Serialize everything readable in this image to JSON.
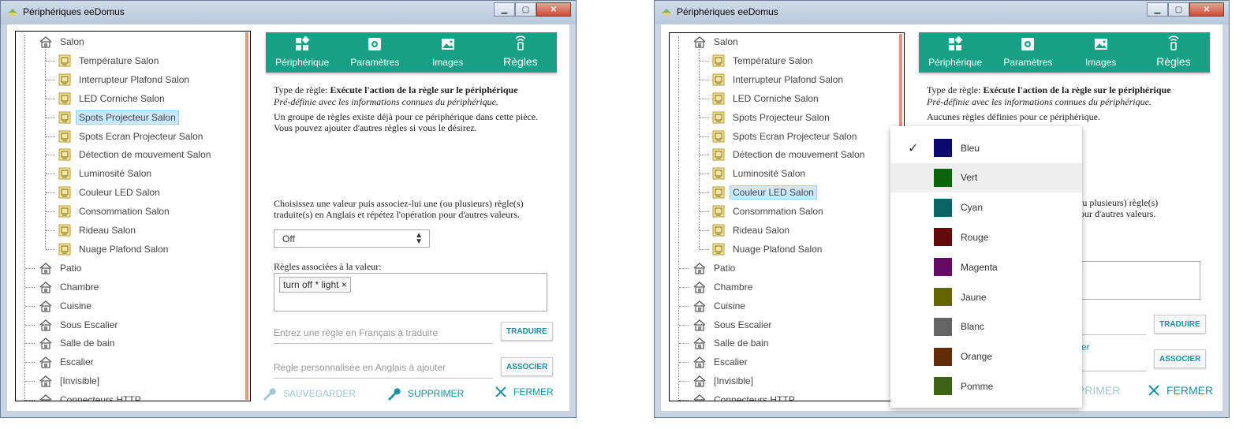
{
  "left_window": {
    "title": "Périphériques eeDomus",
    "tree": {
      "root_label": "Salon",
      "children": [
        "Température Salon",
        "Interrupteur Plafond Salon",
        "LED Corniche Salon",
        "Spots Projecteur Salon",
        "Spots Ecran Projecteur Salon",
        "Détection de mouvement Salon",
        "Luminosité Salon",
        "Couleur LED Salon",
        "Consommation Salon",
        "Rideau Salon",
        "Nuage Plafond Salon"
      ],
      "selected_child": "Spots Projecteur Salon",
      "rooms": [
        "Patio",
        "Chambre",
        "Cuisine",
        "Sous Escalier",
        "Salle de bain",
        "Escalier",
        "[Invisible]",
        "Connecteurs HTTP"
      ]
    },
    "tabs": [
      "Périphérique",
      "Paramètres",
      "Images",
      "Règles"
    ],
    "active_tab": "Règles",
    "rule_type_prefix": "Type de règle: ",
    "rule_type_value": "Exécute l'action de la règle sur le périphérique",
    "rule_type_desc": "Pré-définie avec les informations connues du périphérique.",
    "info_line1": "Un groupe de règles existe déjà pour ce périphérique dans cette pièce.",
    "info_line2": "Vous pouvez ajouter d'autres règles si vous le désirez.",
    "choose_line1": "Choisissez une valeur puis associez-lui une (ou plusieurs) règle(s)",
    "choose_line2": "traduite(s) en Anglais et répétez l'opération pour d'autres valeurs.",
    "select_value": "Off",
    "assoc_label": "Règles associées à la valeur:",
    "tag": "turn off * light",
    "tag_remove": "×",
    "translate_placeholder": "Entrez une règle en Français à traduire",
    "translate_button": "TRADUIRE",
    "custom_placeholder": "Règle personnalisée en Anglais à ajouter",
    "associate_button": "ASSOCIER",
    "save_label": "SAUVEGARDER",
    "delete_label": "SUPPRIMER",
    "close_label": "FERMER"
  },
  "right_window": {
    "title": "Périphériques eeDomus",
    "tree": {
      "root_label": "Salon",
      "children": [
        "Température Salon",
        "Interrupteur Plafond Salon",
        "LED Corniche Salon",
        "Spots Projecteur Salon",
        "Spots Ecran Projecteur Salon",
        "Détection de mouvement Salon",
        "Luminosité Salon",
        "Couleur LED Salon",
        "Consommation Salon",
        "Rideau Salon",
        "Nuage Plafond Salon"
      ],
      "selected_child": "Couleur LED Salon",
      "rooms": [
        "Patio",
        "Chambre",
        "Cuisine",
        "Sous Escalier",
        "Salle de bain",
        "Escalier",
        "[Invisible]",
        "Connecteurs HTTP"
      ]
    },
    "tabs": [
      "Périphérique",
      "Paramètres",
      "Images",
      "Règles"
    ],
    "active_tab": "Règles",
    "rule_type_prefix": "Type de règle: ",
    "rule_type_value": "Exécute l'action de la règle sur le périphérique",
    "rule_type_desc": "Pré-définie avec les informations connues du périphérique.",
    "info_line1": "Aucunes règles définies pour ce périphérique.",
    "choose_partial1": "e (ou plusieurs) règle(s)",
    "choose_partial2": "n pour d'autres valeurs.",
    "translate_partial": "re",
    "custom_partial": "uter",
    "translate_button": "TRADUIRE",
    "associate_button": "ASSOCIER",
    "save_partial": "IPRIMER",
    "close_label": "FERMER"
  },
  "color_dropdown": {
    "selected": "Bleu",
    "hovered": "Vert",
    "check_mark": "✓",
    "options": [
      {
        "label": "Bleu",
        "color": "#0a0a6e"
      },
      {
        "label": "Vert",
        "color": "#0a640a"
      },
      {
        "label": "Cyan",
        "color": "#0a6464"
      },
      {
        "label": "Rouge",
        "color": "#640a0a"
      },
      {
        "label": "Magenta",
        "color": "#640a64"
      },
      {
        "label": "Jaune",
        "color": "#646400"
      },
      {
        "label": "Blanc",
        "color": "#646464"
      },
      {
        "label": "Orange",
        "color": "#642d0a"
      },
      {
        "label": "Pomme",
        "color": "#3c6414"
      }
    ]
  },
  "colors": {
    "tab_bar": "#17a086",
    "button_text": "#1a8fa0",
    "save_disabled": "#9cc9d1",
    "delete": "#1a8fa0",
    "close": "#1a8fa0"
  }
}
